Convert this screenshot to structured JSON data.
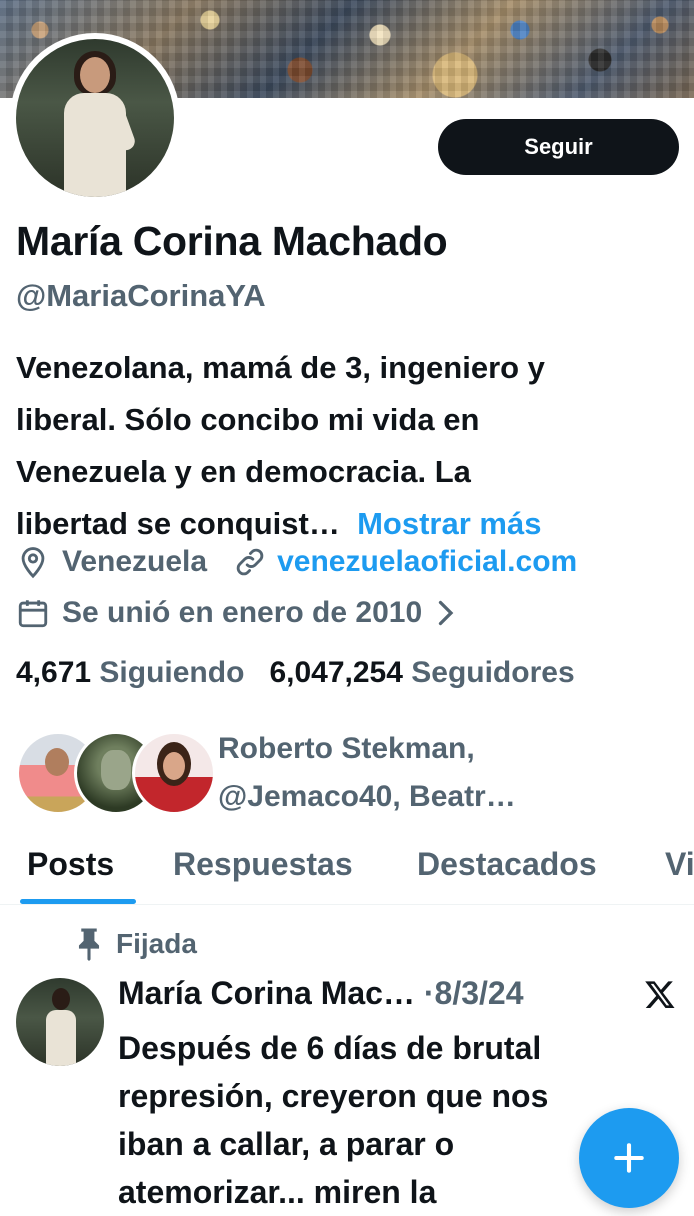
{
  "profile": {
    "name": "María Corina Machado",
    "handle": "@MariaCorinaYA",
    "follow_label": "Seguir",
    "bio_lines": [
      "Venezolana, mamá de 3, ingeniero y",
      "liberal. Sólo concibo mi vida en",
      "Venezuela y en democracia. La",
      "libertad se conquist…"
    ],
    "show_more": "Mostrar más",
    "location": "Venezuela",
    "website": "venezuelaoficial.com",
    "joined": "Se unió en enero de 2010",
    "following_count": "4,671",
    "following_label": "Siguiendo",
    "followers_count": "6,047,254",
    "followers_label": "Seguidores",
    "mutuals_line1": "Roberto Stekman,",
    "mutuals_line2": "@Jemaco40, Beatr…"
  },
  "tabs": [
    "Posts",
    "Respuestas",
    "Destacados",
    "Vi"
  ],
  "post": {
    "pinned_label": "Fijada",
    "author": "María Corina Mac…",
    "separator": "·",
    "date": "8/3/24",
    "text_lines": [
      "Después de 6 días de brutal",
      "represión, creyeron que nos",
      "iban a callar, a parar o",
      "atemorizar... miren la"
    ]
  },
  "icons": [
    "location-icon",
    "link-icon",
    "calendar-icon",
    "chevron-right-icon",
    "pin-icon",
    "x-logo-icon",
    "plus-icon"
  ],
  "colors": {
    "accent": "#1d9bf0",
    "text": "#0f1419",
    "secondary": "#536471"
  }
}
